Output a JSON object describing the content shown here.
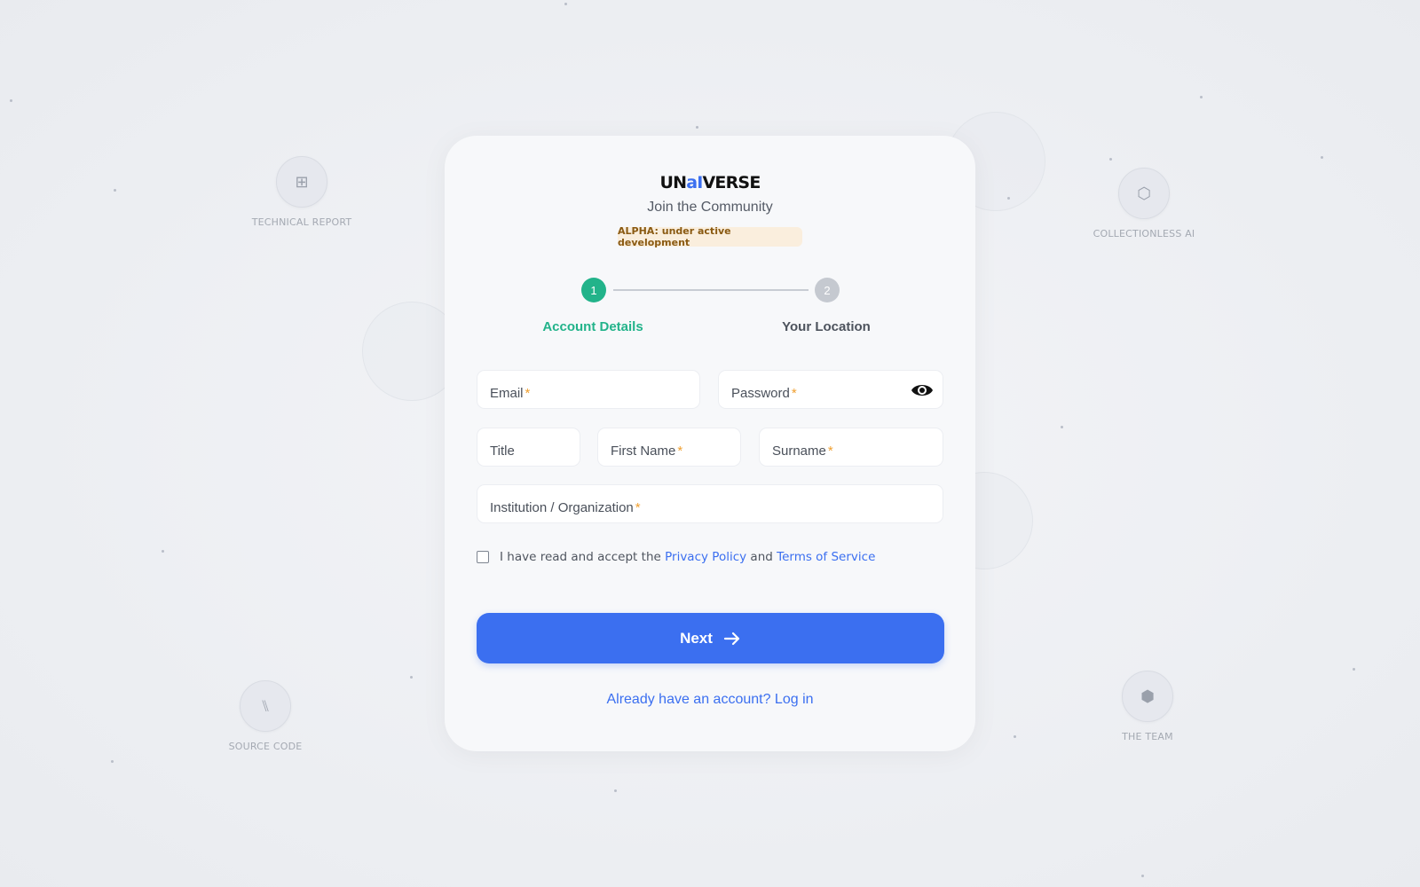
{
  "brand": {
    "part1": "UN",
    "part2": "aI",
    "part3": "VERSE",
    "accent_color": "#3b6ff0"
  },
  "subtitle": "Join the Community",
  "alpha_badge": "ALPHA: under active development",
  "steps": [
    {
      "number": "1",
      "label": "Account Details",
      "state": "active",
      "color": "#22b38a"
    },
    {
      "number": "2",
      "label": "Your Location",
      "state": "inactive",
      "color": "#c5c9d0"
    }
  ],
  "form": {
    "email_label": "Email",
    "password_label": "Password",
    "title_label": "Title",
    "first_name_label": "First Name",
    "surname_label": "Surname",
    "institution_label": "Institution / Organization",
    "required_marker": "*",
    "password_toggle_icon": "eye-icon"
  },
  "consent": {
    "prefix": "I have read and accept the",
    "privacy_link": "Privacy Policy",
    "and": "and",
    "terms_link": "Terms of Service",
    "checked": false
  },
  "next_button": {
    "label": "Next",
    "icon": "arrow-right-icon",
    "color": "#3b6ff0"
  },
  "login_link": "Already have an account? Log in",
  "nav_nodes": [
    {
      "label": "TECHNICAL REPORT",
      "icon": "grid-icon"
    },
    {
      "label": "COLLECTIONLESS AI",
      "icon": "hexagon-outline-icon"
    },
    {
      "label": "SOURCE CODE",
      "icon": "code-icon"
    },
    {
      "label": "THE TEAM",
      "icon": "hexagon-icon"
    }
  ]
}
